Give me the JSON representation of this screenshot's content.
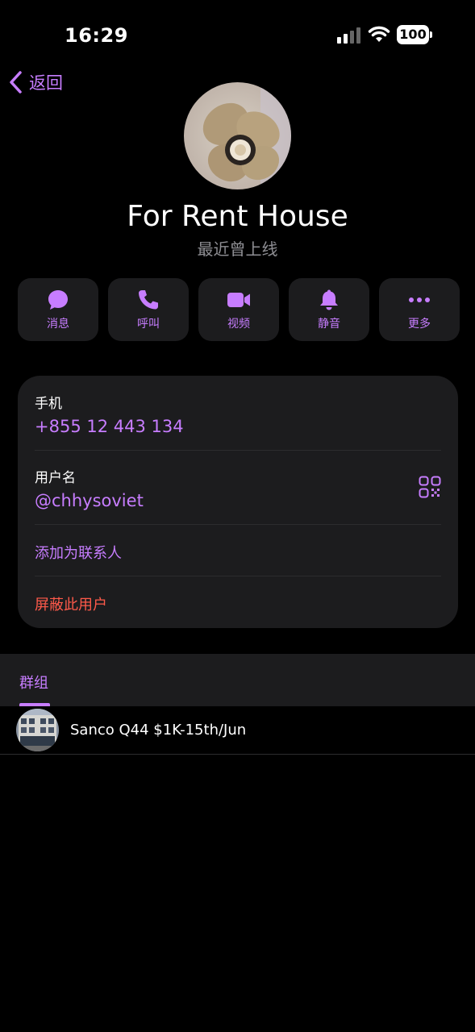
{
  "status_bar": {
    "time": "16:29",
    "battery": "100"
  },
  "nav": {
    "back_label": "返回"
  },
  "profile": {
    "name": "For Rent House",
    "status": "最近曾上线"
  },
  "actions": [
    {
      "label": "消息",
      "icon": "message-icon"
    },
    {
      "label": "呼叫",
      "icon": "phone-icon"
    },
    {
      "label": "视频",
      "icon": "video-icon"
    },
    {
      "label": "静音",
      "icon": "bell-icon"
    },
    {
      "label": "更多",
      "icon": "more-icon"
    }
  ],
  "info": {
    "phone_label": "手机",
    "phone_value": "+855 12 443 134",
    "username_label": "用户名",
    "username_value": "@chhysoviet",
    "add_contact": "添加为联系人",
    "block_user": "屏蔽此用户"
  },
  "groups": {
    "tab_label": "群组",
    "items": [
      {
        "name": "Sanco Q44 $1K-15th/Jun"
      }
    ]
  },
  "colors": {
    "accent": "#c77dff",
    "danger": "#ff5a4a",
    "card_bg": "#1c1c1e",
    "background": "#000000"
  }
}
